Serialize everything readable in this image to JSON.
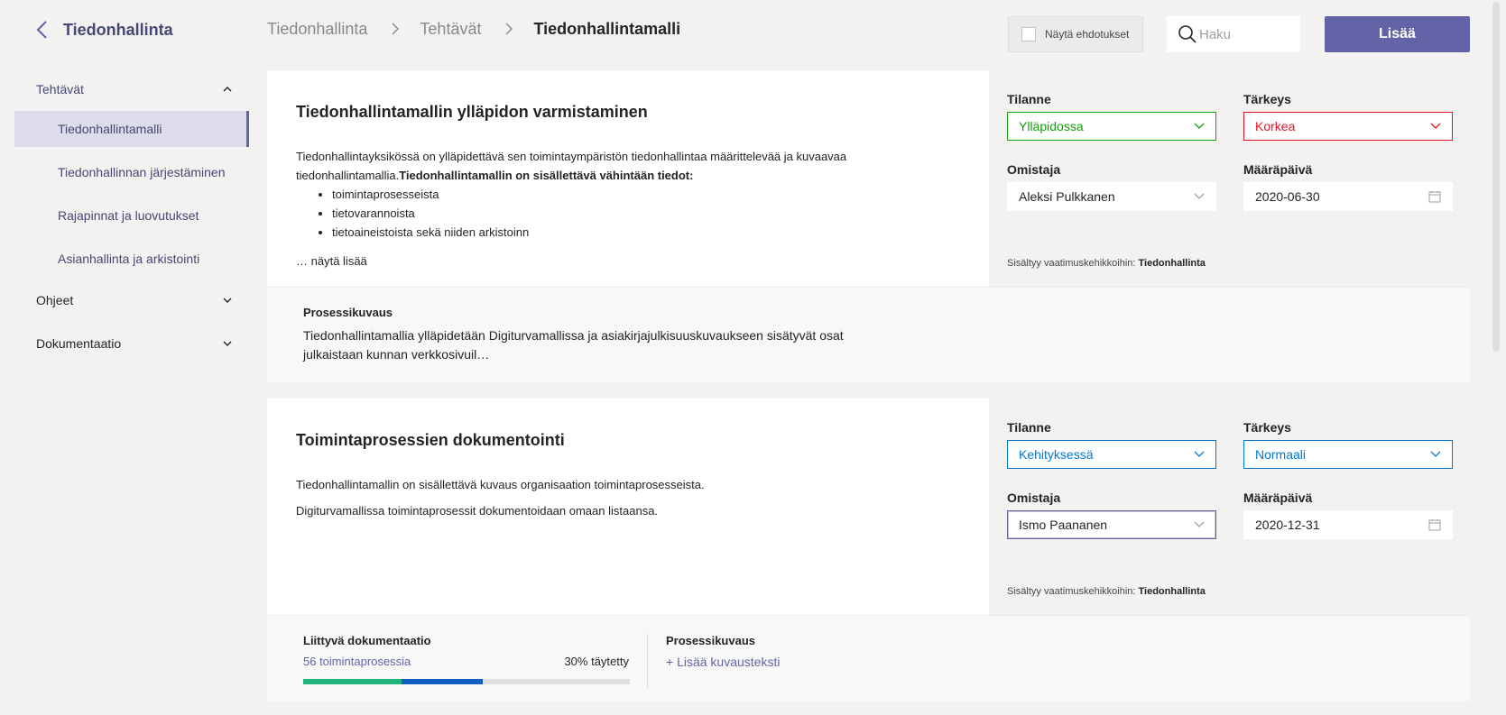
{
  "app": {
    "title": "Tiedonhallinta"
  },
  "nav": {
    "groups": [
      {
        "label": "Tehtävät",
        "items": [
          "Tiedonhallintamalli",
          "Tiedonhallinnan järjestäminen",
          "Rajapinnat ja luovutukset",
          "Asianhallinta ja arkistointi"
        ]
      },
      {
        "label": "Ohjeet"
      },
      {
        "label": "Dokumentaatio"
      }
    ]
  },
  "breadcrumb": {
    "items": [
      "Tiedonhallinta",
      "Tehtävät",
      "Tiedonhallintamalli"
    ]
  },
  "header": {
    "suggestions_label": "Näytä ehdotukset",
    "search_placeholder": "Haku",
    "add_label": "Lisää"
  },
  "card1": {
    "title": "Tiedonhallintamallin ylläpidon varmistaminen",
    "desc_text": "Tiedonhallintayksikössä on ylläpidettävä sen toimintaympäristön tiedonhallintaa määrittelevää ja kuvaavaa tiedonhallintamallia.",
    "desc_bold": "Tiedonhallintamallin on sisällettävä vähintään tiedot:",
    "bullets": [
      "toimintaprosesseista",
      "tietovarannoista",
      "tietoaineistoista sekä niiden arkistoinn"
    ],
    "more_prefix": "… ",
    "more_link": "näytä lisää",
    "status_label": "Tilanne",
    "status_value": "Ylläpidossa",
    "priority_label": "Tärkeys",
    "priority_value": "Korkea",
    "owner_label": "Omistaja",
    "owner_value": "Aleksi Pulkkanen",
    "due_label": "Määräpäivä",
    "due_value": "2020-06-30",
    "included_prefix": "Sisältyy vaatimuskehikkoihin: ",
    "included_value": "Tiedonhallinta",
    "process_label": "Prosessikuvaus",
    "process_text": "Tiedonhallintamallia ylläpidetään Digiturvamallissa ja asiakirjajulkisuuskuvaukseen sisätyvät osat julkaistaan kunnan verkkosivuil…"
  },
  "card2": {
    "title": "Toimintaprosessien dokumentointi",
    "para1": "Tiedonhallintamallin on sisällettävä kuvaus organisaation toimintaprosesseista.",
    "para2": "Digiturvamallissa toimintaprosessit dokumentoidaan omaan listaansa.",
    "status_label": "Tilanne",
    "status_value": "Kehityksessä",
    "priority_label": "Tärkeys",
    "priority_value": "Normaali",
    "owner_label": "Omistaja",
    "owner_value": "Ismo Paananen",
    "due_label": "Määräpäivä",
    "due_value": "2020-12-31",
    "included_prefix": "Sisältyy vaatimuskehikkoihin: ",
    "included_value": "Tiedonhallinta",
    "docs_label": "Liittyvä dokumentaatio",
    "docs_link": "56 toimintaprosessia",
    "docs_progress_text": "30% täytetty",
    "docs_progress": {
      "green_fraction": 0.3,
      "blue_fraction": 0.25
    },
    "process_label": "Prosessikuvaus",
    "add_desc_link": "+ Lisää kuvausteksti"
  },
  "colors": {
    "brand": "#6264a7",
    "status_green": "#13a10e",
    "priority_red": "#e81123",
    "status_blue": "#0078d4"
  },
  "icons": [
    "back-chevron-icon",
    "chevron-up-icon",
    "chevron-down-icon",
    "chevron-right-icon",
    "search-icon",
    "calendar-icon",
    "checkbox-icon"
  ]
}
